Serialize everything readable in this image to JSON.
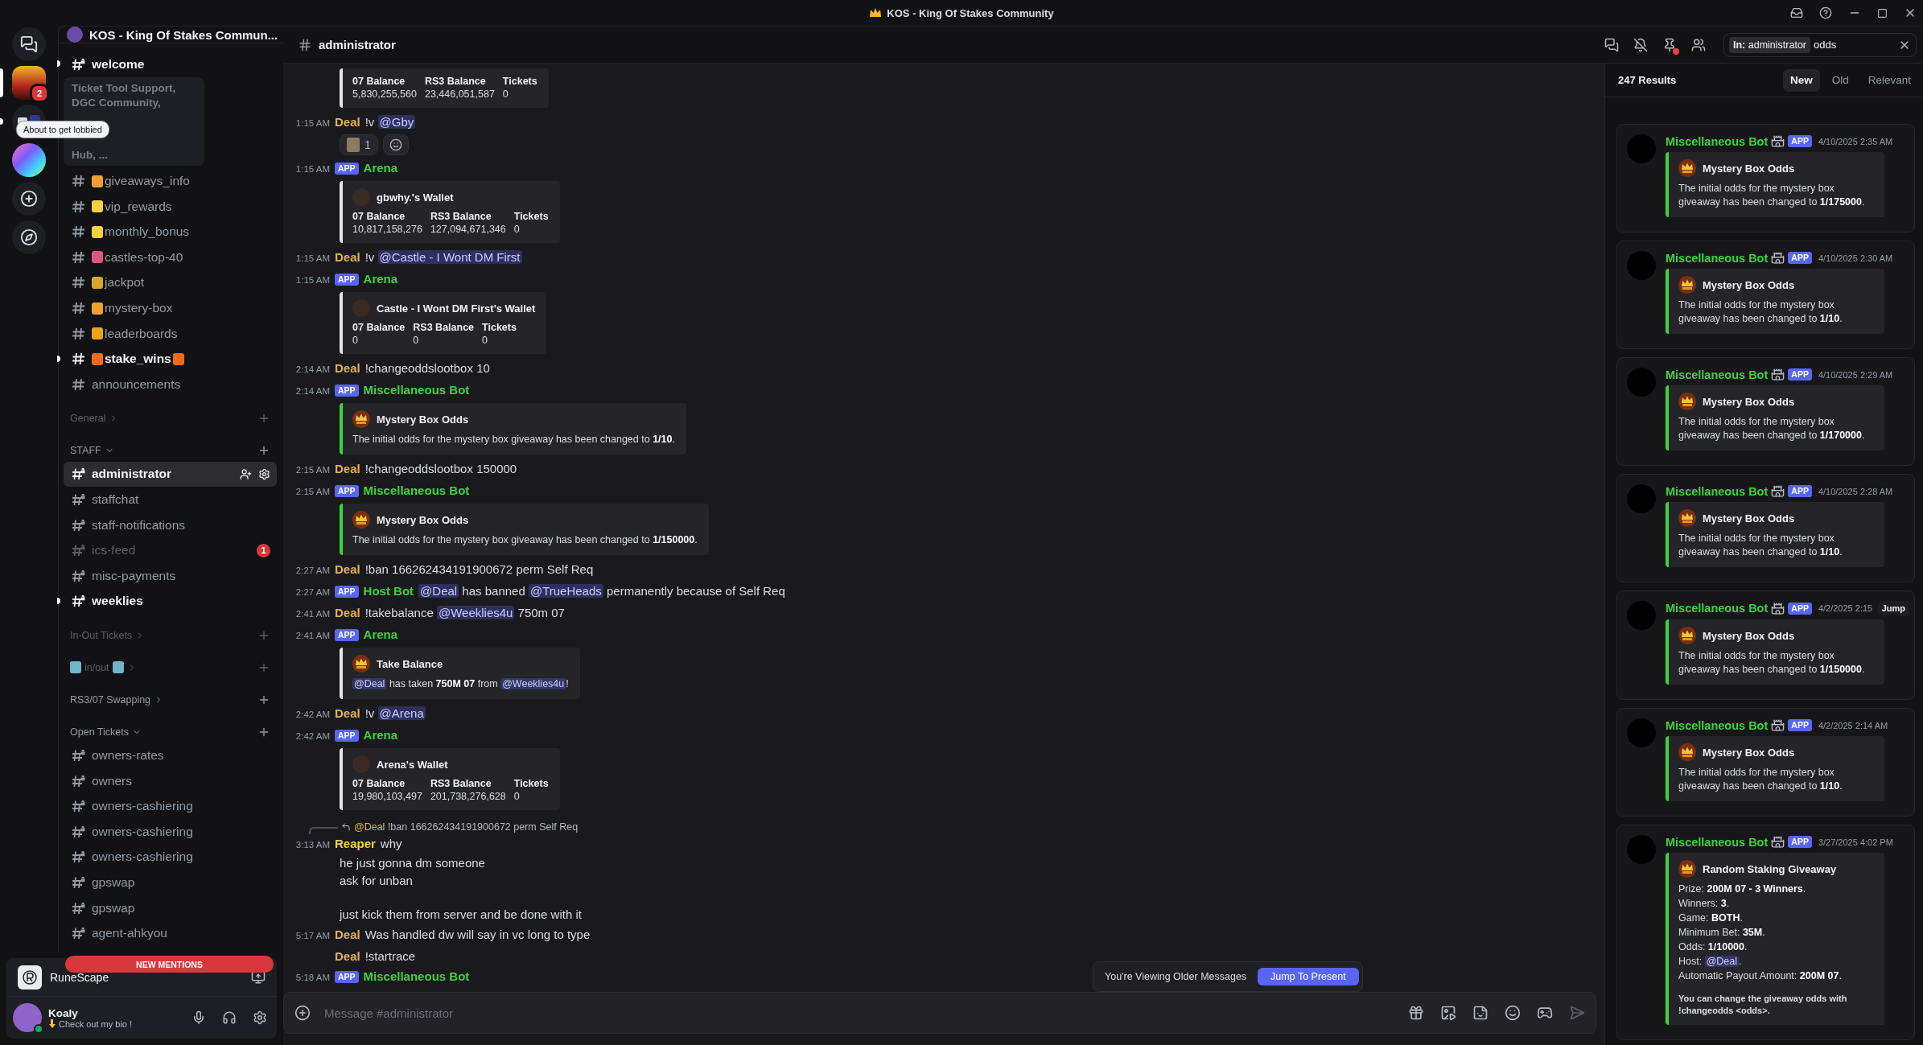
{
  "window": {
    "title": "KOS - King Of Stakes Community"
  },
  "rail": {
    "tooltip": "About to get lobbied",
    "servers": [
      {
        "kind": "home",
        "selected": false
      },
      {
        "kind": "kos",
        "selected": true,
        "badge": "2"
      },
      {
        "kind": "folder",
        "selected": false,
        "unread": true
      },
      {
        "kind": "app",
        "selected": false
      },
      {
        "kind": "add",
        "selected": false
      },
      {
        "kind": "discover",
        "selected": false
      }
    ]
  },
  "sidebar": {
    "server_name": "KOS - King Of Stakes Commun...",
    "items": [
      {
        "kind": "channel",
        "name": "welcome",
        "locked": true,
        "unread": true,
        "selected": false,
        "muted": false
      },
      {
        "kind": "folder_preview",
        "lines": [
          "Ticket Tool Support,",
          "DGC Community,",
          "Hub, ..."
        ]
      },
      {
        "kind": "channel",
        "name": "giveaways_info",
        "emoji": {
          "color": "#f0a030"
        },
        "locked": false,
        "unread": false,
        "selected": false,
        "muted": false
      },
      {
        "kind": "channel",
        "name": "vip_rewards",
        "emoji": {
          "color": "#f5d142"
        },
        "locked": false,
        "unread": false,
        "selected": false,
        "muted": false
      },
      {
        "kind": "channel",
        "name": "monthly_bonus",
        "emoji": {
          "color": "#f5d142"
        },
        "locked": false,
        "unread": false,
        "selected": false,
        "muted": false
      },
      {
        "kind": "channel",
        "name": "castles-top-40",
        "emoji": {
          "color": "#e0567a"
        },
        "locked": false,
        "unread": false,
        "selected": false,
        "muted": false
      },
      {
        "kind": "channel",
        "name": "jackpot",
        "emoji": {
          "color": "#d9a531"
        },
        "locked": false,
        "unread": false,
        "selected": false,
        "muted": false
      },
      {
        "kind": "channel",
        "name": "mystery-box",
        "emoji": {
          "color": "#f0a030"
        },
        "locked": false,
        "unread": false,
        "selected": false,
        "muted": false
      },
      {
        "kind": "channel",
        "name": "leaderboards",
        "emoji": {
          "color": "#e8a317"
        },
        "locked": false,
        "unread": false,
        "selected": false,
        "muted": false
      },
      {
        "kind": "channel",
        "name": "stake_wins",
        "emoji": {
          "color": "#f26b1d"
        },
        "trailing_emoji": {
          "color": "#f26b1d"
        },
        "locked": false,
        "unread": true,
        "selected": false,
        "muted": false
      },
      {
        "kind": "channel",
        "name": "announcements",
        "locked": false,
        "unread": false,
        "selected": false,
        "muted": false
      },
      {
        "kind": "category",
        "name": "General",
        "expanded": false,
        "muted": true
      },
      {
        "kind": "category",
        "name": "STAFF",
        "expanded": true,
        "muted": false
      },
      {
        "kind": "channel",
        "name": "administrator",
        "locked": true,
        "unread": false,
        "selected": true,
        "muted": false
      },
      {
        "kind": "channel",
        "name": "staffchat",
        "locked": true,
        "unread": false,
        "selected": false,
        "muted": false
      },
      {
        "kind": "channel",
        "name": "staff-notifications",
        "locked": true,
        "unread": false,
        "selected": false,
        "muted": false
      },
      {
        "kind": "channel",
        "name": "ics-feed",
        "locked": true,
        "unread": false,
        "selected": false,
        "muted": true,
        "badge": "1"
      },
      {
        "kind": "channel",
        "name": "misc-payments",
        "locked": true,
        "unread": false,
        "selected": false,
        "muted": false
      },
      {
        "kind": "channel",
        "name": "weeklies",
        "locked": true,
        "unread": true,
        "selected": false,
        "muted": false
      },
      {
        "kind": "category",
        "name": "In-Out Tickets",
        "expanded": false,
        "muted": true
      },
      {
        "kind": "category",
        "name": "in/out",
        "emoji": {
          "color": "#6fb6c9"
        },
        "trailing_emoji": {
          "color": "#6fb6c9"
        },
        "expanded": false,
        "muted": true
      },
      {
        "kind": "category",
        "name": "RS3/07 Swapping",
        "expanded": false,
        "muted": false
      },
      {
        "kind": "category",
        "name": "Open Tickets",
        "expanded": true,
        "muted": false
      },
      {
        "kind": "channel",
        "name": "owners-rates",
        "locked": true,
        "unread": false,
        "selected": false,
        "muted": false
      },
      {
        "kind": "channel",
        "name": "owners",
        "locked": true,
        "unread": false,
        "selected": false,
        "muted": false
      },
      {
        "kind": "channel",
        "name": "owners-cashiering",
        "locked": true,
        "unread": false,
        "selected": false,
        "muted": false
      },
      {
        "kind": "channel",
        "name": "owners-cashiering",
        "locked": true,
        "unread": false,
        "selected": false,
        "muted": false
      },
      {
        "kind": "channel",
        "name": "owners-cashiering",
        "locked": true,
        "unread": false,
        "selected": false,
        "muted": false
      },
      {
        "kind": "channel",
        "name": "gpswap",
        "locked": true,
        "unread": false,
        "selected": false,
        "muted": false
      },
      {
        "kind": "channel",
        "name": "gpswap",
        "locked": true,
        "unread": false,
        "selected": false,
        "muted": false
      },
      {
        "kind": "channel",
        "name": "agent-ahkyou",
        "locked": true,
        "unread": false,
        "selected": false,
        "muted": false
      }
    ],
    "new_mentions": "NEW MENTIONS"
  },
  "activity": {
    "name": "RuneScape"
  },
  "user": {
    "name": "Koaly",
    "status": "Check out my bio !"
  },
  "header": {
    "channel": "administrator",
    "pins_unread": true,
    "search": {
      "filter_label": "In:",
      "filter_value": "administrator",
      "value": "odds"
    }
  },
  "messages": [
    {
      "kind": "embed_only",
      "embed": {
        "color": "#e3e5e8",
        "fields": [
          {
            "name": "07 Balance",
            "value": "5,830,255,560"
          },
          {
            "name": "RS3 Balance",
            "value": "23,446,051,587"
          },
          {
            "name": "Tickets",
            "value": "0"
          }
        ]
      }
    },
    {
      "kind": "message",
      "time": "1:15 AM",
      "author": "Deal",
      "color": "#e3b14f",
      "content": [
        {
          "kind": "text",
          "text": "!v "
        },
        {
          "kind": "mention",
          "text": "@Gby"
        }
      ],
      "reactions": [
        {
          "count": "1"
        }
      ]
    },
    {
      "kind": "message",
      "time": "1:15 AM",
      "badge": "APP",
      "author": "Arena",
      "color": "#3fd13f",
      "embed": {
        "color": "#e3e5e8",
        "title": "gbwhy.'s Wallet",
        "fields": [
          {
            "name": "07 Balance",
            "value": "10,817,158,276"
          },
          {
            "name": "RS3 Balance",
            "value": "127,094,671,346"
          },
          {
            "name": "Tickets",
            "value": "0"
          }
        ]
      }
    },
    {
      "kind": "message",
      "time": "1:15 AM",
      "author": "Deal",
      "color": "#e3b14f",
      "content": [
        {
          "kind": "text",
          "text": "!v "
        },
        {
          "kind": "mention",
          "text": "@Castle - I Wont DM First"
        }
      ]
    },
    {
      "kind": "message",
      "time": "1:15 AM",
      "badge": "APP",
      "author": "Arena",
      "color": "#3fd13f",
      "embed": {
        "color": "#e3e5e8",
        "title": "Castle - I Wont DM First's Wallet",
        "fields": [
          {
            "name": "07 Balance",
            "value": "0"
          },
          {
            "name": "RS3 Balance",
            "value": "0"
          },
          {
            "name": "Tickets",
            "value": "0"
          }
        ]
      }
    },
    {
      "kind": "message",
      "time": "2:14 AM",
      "author": "Deal",
      "color": "#e3b14f",
      "content": [
        {
          "kind": "text",
          "text": "!changeoddslootbox 10"
        }
      ]
    },
    {
      "kind": "message",
      "time": "2:14 AM",
      "badge": "APP",
      "author": "Miscellaneous Bot",
      "color": "#3fd13f",
      "embed": {
        "color": "#3bd43b",
        "title": "Mystery Box Odds",
        "description": [
          [
            {
              "kind": "text",
              "text": "The initial odds for the mystery box giveaway has been changed to "
            },
            {
              "kind": "bold",
              "text": "1/10"
            },
            {
              "kind": "text",
              "text": "."
            }
          ]
        ]
      }
    },
    {
      "kind": "message",
      "time": "2:15 AM",
      "author": "Deal",
      "color": "#e3b14f",
      "content": [
        {
          "kind": "text",
          "text": "!changeoddslootbox 150000"
        }
      ]
    },
    {
      "kind": "message",
      "time": "2:15 AM",
      "badge": "APP",
      "author": "Miscellaneous Bot",
      "color": "#3fd13f",
      "embed": {
        "color": "#3bd43b",
        "title": "Mystery Box Odds",
        "description": [
          [
            {
              "kind": "text",
              "text": "The initial odds for the mystery box giveaway has been changed to "
            },
            {
              "kind": "bold",
              "text": "1/150000"
            },
            {
              "kind": "text",
              "text": "."
            }
          ]
        ]
      }
    },
    {
      "kind": "message",
      "time": "2:27 AM",
      "author": "Deal",
      "color": "#e3b14f",
      "content": [
        {
          "kind": "text",
          "text": "!ban 166262434191900672 perm Self Req"
        }
      ]
    },
    {
      "kind": "message",
      "time": "2:27 AM",
      "badge": "APP",
      "author": "Host Bot",
      "color": "#3fd13f",
      "content": [
        {
          "kind": "mention",
          "text": "@Deal"
        },
        {
          "kind": "text",
          "text": " has banned "
        },
        {
          "kind": "mention",
          "text": "@TrueHeads"
        },
        {
          "kind": "text",
          "text": " permanently because of Self Req"
        }
      ]
    },
    {
      "kind": "message",
      "time": "2:41 AM",
      "author": "Deal",
      "color": "#e3b14f",
      "content": [
        {
          "kind": "text",
          "text": "!takebalance "
        },
        {
          "kind": "mention",
          "text": "@Weeklies4u"
        },
        {
          "kind": "text",
          "text": " 750m 07"
        }
      ]
    },
    {
      "kind": "message",
      "time": "2:41 AM",
      "badge": "APP",
      "author": "Arena",
      "color": "#3fd13f",
      "embed": {
        "color": "#e3e5e8",
        "title": "Take Balance",
        "description": [
          [
            {
              "kind": "mention",
              "text": "@Deal"
            },
            {
              "kind": "text",
              "text": " has taken "
            },
            {
              "kind": "bold",
              "text": "750M 07"
            },
            {
              "kind": "text",
              "text": " from "
            },
            {
              "kind": "mention",
              "text": "@Weeklies4u"
            },
            {
              "kind": "text",
              "text": "!"
            }
          ]
        ]
      }
    },
    {
      "kind": "message",
      "time": "2:42 AM",
      "author": "Deal",
      "color": "#e3b14f",
      "content": [
        {
          "kind": "text",
          "text": "!v "
        },
        {
          "kind": "mention",
          "text": "@Arena"
        }
      ]
    },
    {
      "kind": "message",
      "time": "2:42 AM",
      "badge": "APP",
      "author": "Arena",
      "color": "#3fd13f",
      "embed": {
        "color": "#e3e5e8",
        "title": "Arena's Wallet",
        "fields": [
          {
            "name": "07 Balance",
            "value": "19,980,103,497"
          },
          {
            "name": "RS3 Balance",
            "value": "201,738,276,628"
          },
          {
            "name": "Tickets",
            "value": "0"
          }
        ]
      }
    },
    {
      "kind": "message",
      "time": "3:13 AM",
      "author": "Reaper",
      "color": "#f2d33c",
      "reply": {
        "author": "@Deal",
        "text": "!ban 166262434191900672 perm Self Req"
      },
      "content": [
        {
          "kind": "text",
          "text": "why"
        }
      ],
      "extra_lines": [
        "he just gonna dm someone",
        "ask for unban"
      ]
    },
    {
      "kind": "message",
      "continuation": "just kick them from server and be done with it"
    },
    {
      "kind": "message",
      "time": "5:17 AM",
      "author": "Deal",
      "color": "#e3b14f",
      "content": [
        {
          "kind": "text",
          "text": "Was handled dw will say in vc long to type"
        }
      ]
    },
    {
      "kind": "message",
      "author": "Deal",
      "color": "#e3b14f",
      "content": [
        {
          "kind": "text",
          "text": "!startrace"
        }
      ]
    },
    {
      "kind": "message",
      "time": "5:18 AM",
      "badge": "APP",
      "author": "Miscellaneous Bot",
      "color": "#3fd13f"
    }
  ],
  "older_bar": {
    "text": "You're Viewing Older Messages",
    "button": "Jump To Present"
  },
  "composer": {
    "placeholder": "Message #administrator"
  },
  "search_results": {
    "count": "247 Results",
    "tabs": [
      {
        "label": "New",
        "selected": true
      },
      {
        "label": "Old",
        "selected": false
      },
      {
        "label": "Relevant",
        "selected": false
      }
    ],
    "results": [
      {
        "author": "Miscellaneous Bot",
        "badge": "APP",
        "date": "4/10/2025 2:35 AM",
        "embed": {
          "color": "#3bd43b",
          "title": "Mystery Box Odds",
          "description": [
            [
              {
                "kind": "text",
                "text": "The initial odds for the mystery box giveaway has been changed to "
              },
              {
                "kind": "bold",
                "text": "1/175000"
              },
              {
                "kind": "text",
                "text": "."
              }
            ]
          ]
        }
      },
      {
        "author": "Miscellaneous Bot",
        "badge": "APP",
        "date": "4/10/2025 2:30 AM",
        "embed": {
          "color": "#3bd43b",
          "title": "Mystery Box Odds",
          "description": [
            [
              {
                "kind": "text",
                "text": "The initial odds for the mystery box giveaway has been changed to "
              },
              {
                "kind": "bold",
                "text": "1/10"
              },
              {
                "kind": "text",
                "text": "."
              }
            ]
          ]
        }
      },
      {
        "author": "Miscellaneous Bot",
        "badge": "APP",
        "date": "4/10/2025 2:29 AM",
        "embed": {
          "color": "#3bd43b",
          "title": "Mystery Box Odds",
          "description": [
            [
              {
                "kind": "text",
                "text": "The initial odds for the mystery box giveaway has been changed to "
              },
              {
                "kind": "bold",
                "text": "1/170000"
              },
              {
                "kind": "text",
                "text": "."
              }
            ]
          ]
        }
      },
      {
        "author": "Miscellaneous Bot",
        "badge": "APP",
        "date": "4/10/2025 2:28 AM",
        "embed": {
          "color": "#3bd43b",
          "title": "Mystery Box Odds",
          "description": [
            [
              {
                "kind": "text",
                "text": "The initial odds for the mystery box giveaway has been changed to "
              },
              {
                "kind": "bold",
                "text": "1/10"
              },
              {
                "kind": "text",
                "text": "."
              }
            ]
          ]
        }
      },
      {
        "author": "Miscellaneous Bot",
        "badge": "APP",
        "date": "4/2/2025 2:15",
        "jump": "Jump",
        "embed": {
          "color": "#3bd43b",
          "title": "Mystery Box Odds",
          "description": [
            [
              {
                "kind": "text",
                "text": "The initial odds for the mystery box giveaway has been changed to "
              },
              {
                "kind": "bold",
                "text": "1/150000"
              },
              {
                "kind": "text",
                "text": "."
              }
            ]
          ]
        }
      },
      {
        "author": "Miscellaneous Bot",
        "badge": "APP",
        "date": "4/2/2025 2:14 AM",
        "embed": {
          "color": "#3bd43b",
          "title": "Mystery Box Odds",
          "description": [
            [
              {
                "kind": "text",
                "text": "The initial odds for the mystery box giveaway has been changed to "
              },
              {
                "kind": "bold",
                "text": "1/10"
              },
              {
                "kind": "text",
                "text": "."
              }
            ]
          ]
        }
      },
      {
        "author": "Miscellaneous Bot",
        "badge": "APP",
        "date": "3/27/2025 4:02 PM",
        "embed": {
          "color": "#3bd43b",
          "title": "Random Staking Giveaway",
          "description": [
            [
              {
                "kind": "text",
                "text": "Prize: "
              },
              {
                "kind": "bold",
                "text": "200M 07 - 3 Winners"
              },
              {
                "kind": "text",
                "text": "."
              }
            ],
            [
              {
                "kind": "text",
                "text": "Winners: "
              },
              {
                "kind": "bold",
                "text": "3"
              },
              {
                "kind": "text",
                "text": "."
              }
            ],
            [
              {
                "kind": "text",
                "text": "Game: "
              },
              {
                "kind": "bold",
                "text": "BOTH"
              },
              {
                "kind": "text",
                "text": "."
              }
            ],
            [
              {
                "kind": "text",
                "text": "Minimum Bet: "
              },
              {
                "kind": "bold",
                "text": "35M"
              },
              {
                "kind": "text",
                "text": "."
              }
            ],
            [
              {
                "kind": "text",
                "text": "Odds: "
              },
              {
                "kind": "bold",
                "text": "1/10000"
              },
              {
                "kind": "text",
                "text": "."
              }
            ],
            [
              {
                "kind": "text",
                "text": "Host: "
              },
              {
                "kind": "mention",
                "text": "@Deal"
              },
              {
                "kind": "text",
                "text": "."
              }
            ],
            [
              {
                "kind": "text",
                "text": "Automatic Payout Amount: "
              },
              {
                "kind": "bold",
                "text": "200M 07"
              },
              {
                "kind": "text",
                "text": "."
              }
            ]
          ],
          "footer": "You can change the giveaway odds with !changeodds <odds>."
        }
      }
    ]
  }
}
